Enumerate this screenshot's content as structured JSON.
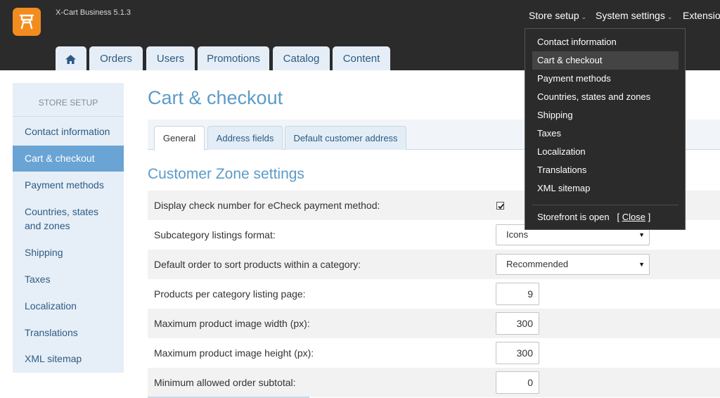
{
  "app": {
    "version": "X-Cart Business 5.1.3"
  },
  "colors": {
    "brand": "#f28c1e",
    "topbar": "#2b2b2b",
    "accent": "#6aa4d4",
    "title": "#5c9bc8"
  },
  "top_nav": {
    "store_setup": "Store setup",
    "system_settings": "System settings",
    "extensions": "Extensions"
  },
  "main_tabs": {
    "home_icon": "home-icon",
    "items": [
      {
        "label": "Orders"
      },
      {
        "label": "Users"
      },
      {
        "label": "Promotions"
      },
      {
        "label": "Catalog"
      },
      {
        "label": "Content"
      }
    ]
  },
  "sidebar": {
    "title": "STORE SETUP",
    "items": [
      {
        "label": "Contact information"
      },
      {
        "label": "Cart & checkout",
        "active": true
      },
      {
        "label": "Payment methods"
      },
      {
        "label": "Countries, states and zones"
      },
      {
        "label": "Shipping"
      },
      {
        "label": "Taxes"
      },
      {
        "label": "Localization"
      },
      {
        "label": "Translations"
      },
      {
        "label": "XML sitemap"
      }
    ]
  },
  "page": {
    "title": "Cart & checkout"
  },
  "sub_tabs": [
    {
      "label": "General",
      "active": true
    },
    {
      "label": "Address fields"
    },
    {
      "label": "Default customer address"
    }
  ],
  "section": {
    "title": "Customer Zone settings"
  },
  "settings": [
    {
      "label": "Display check number for eCheck payment method:",
      "checked": true
    },
    {
      "label": "Subcategory listings format:",
      "value": "Icons"
    },
    {
      "label": "Default order to sort products within a category:",
      "value": "Recommended"
    },
    {
      "label": "Products per category listing page:",
      "value": "9"
    },
    {
      "label": "Maximum product image width (px):",
      "value": "300"
    },
    {
      "label": "Maximum product image height (px):",
      "value": "300"
    },
    {
      "label": "Minimum allowed order subtotal:",
      "value": "0"
    }
  ],
  "dropdown": {
    "items": [
      {
        "label": "Contact information"
      },
      {
        "label": "Cart & checkout",
        "active": true
      },
      {
        "label": "Payment methods"
      },
      {
        "label": "Countries, states and zones"
      },
      {
        "label": "Shipping"
      },
      {
        "label": "Taxes"
      },
      {
        "label": "Localization"
      },
      {
        "label": "Translations"
      },
      {
        "label": "XML sitemap"
      }
    ],
    "storefront_text": "Storefront is open",
    "close_open": "[",
    "close_label": "Close",
    "close_close": "]"
  }
}
